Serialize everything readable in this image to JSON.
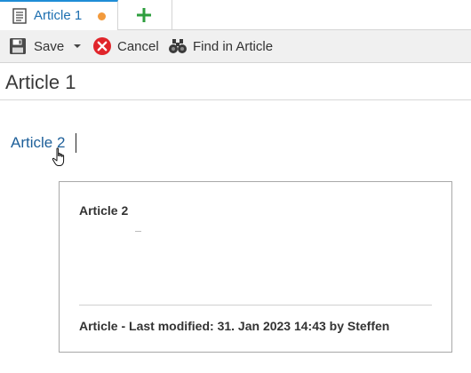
{
  "tabs": [
    {
      "label": "Article 1",
      "icon": "document-icon",
      "unsaved": true,
      "dirty_color": "#f29a3c"
    }
  ],
  "new_tab_icon": "plus-icon",
  "toolbar": {
    "save_label": "Save",
    "cancel_label": "Cancel",
    "find_label": "Find in Article"
  },
  "page": {
    "title": "Article 1"
  },
  "editor": {
    "link_text": "Article 2"
  },
  "popup": {
    "title": "Article 2",
    "meta": "Article - Last modified: 31. Jan 2023 14:43 by Steffen"
  },
  "colors": {
    "accent": "#1f8dd6",
    "link": "#1d5f99",
    "add": "#2e9e3e",
    "cancel": "#e0252b"
  }
}
